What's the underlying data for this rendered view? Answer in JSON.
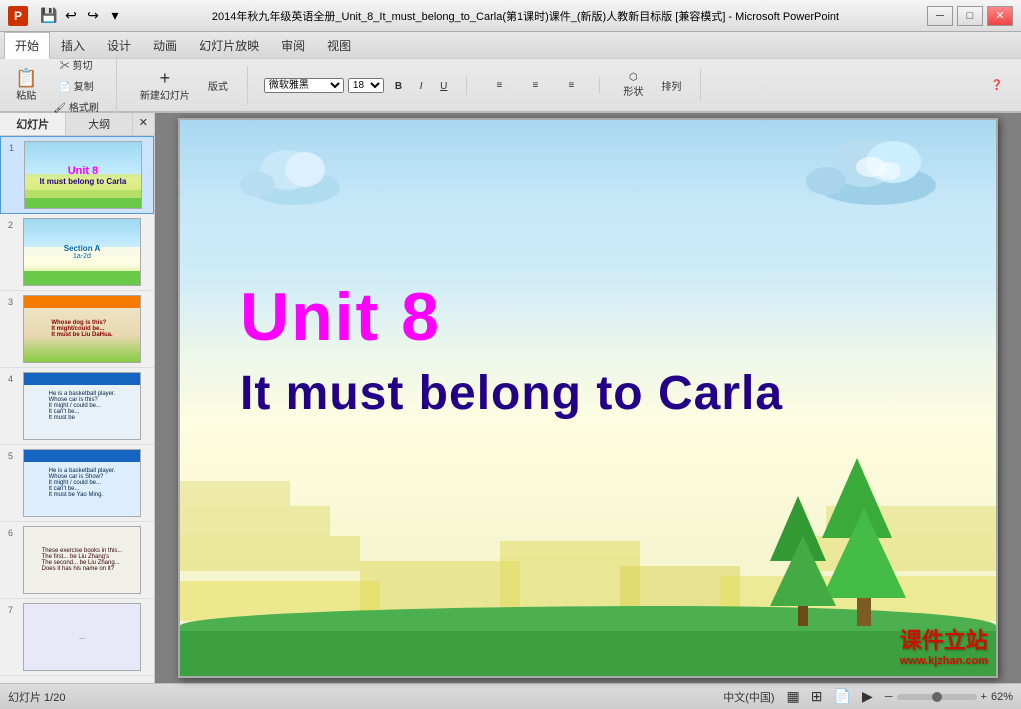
{
  "titlebar": {
    "icon_label": "P",
    "title": "2014年秋九年级英语全册_Unit_8_It_must_belong_to_Carla(第1课时)课件_(新版)人教新目标版 [兼容模式] - Microsoft PowerPoint",
    "minimize": "─",
    "maximize": "□",
    "close": "✕"
  },
  "quickaccess": {
    "save": "💾",
    "undo": "↩",
    "redo": "↪",
    "customize": "▾"
  },
  "ribbon": {
    "tabs": [
      "开始",
      "插入",
      "设计",
      "动画",
      "幻灯片放映",
      "审阅",
      "视图"
    ],
    "active_tab": "开始"
  },
  "panel": {
    "tab1": "幻灯片",
    "tab2": "大纲",
    "close": "✕"
  },
  "slides": [
    {
      "num": "1",
      "type": "main_title"
    },
    {
      "num": "2",
      "type": "section_a",
      "text": "Section A\n1a-2d"
    },
    {
      "num": "3",
      "type": "exercise3"
    },
    {
      "num": "4",
      "type": "exercise4"
    },
    {
      "num": "5",
      "type": "exercise5"
    },
    {
      "num": "6",
      "type": "exercise6"
    },
    {
      "num": "7",
      "type": "exercise7"
    }
  ],
  "main_slide": {
    "unit_number": "Unit 8",
    "subtitle": "It must belong to Carla",
    "watermark_line1": "课件立站",
    "watermark_line2": "www.kjzhan.com",
    "unit_color": "#ff00ff",
    "subtitle_color": "#220088"
  },
  "statusbar": {
    "slide_info": "幻灯片 1/20",
    "theme": "",
    "language": "中文(中国)",
    "zoom_percent": "62%",
    "view_normal": "▦",
    "view_slide_sorter": "⊞",
    "view_reading": "📖",
    "view_slideshow": "▶"
  }
}
